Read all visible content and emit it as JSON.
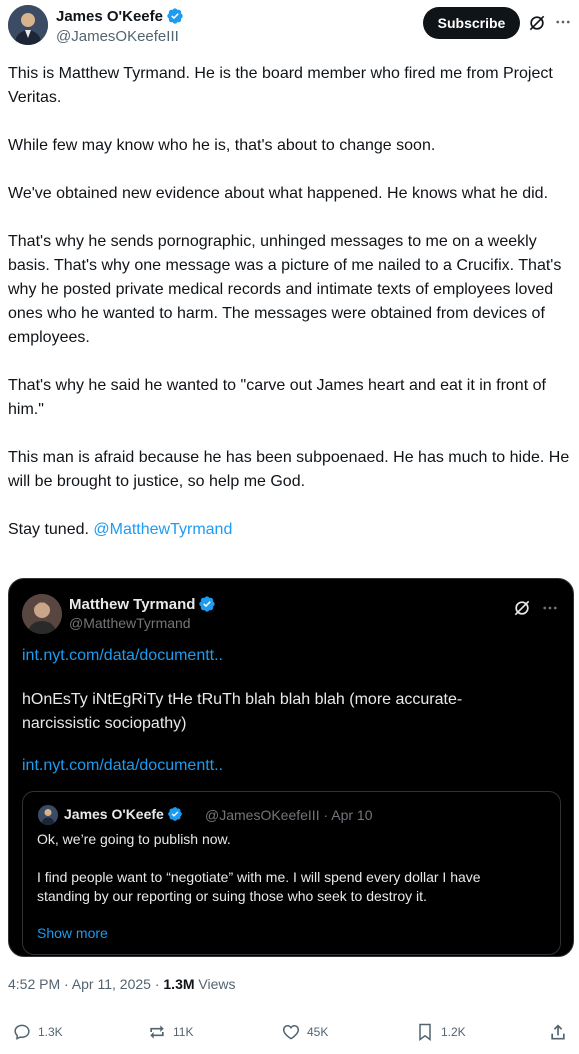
{
  "author": {
    "name": "James O'Keefe",
    "handle": "@JamesOKeefeIII"
  },
  "header": {
    "subscribe_label": "Subscribe"
  },
  "tweet": {
    "paragraphs": [
      "This is Matthew Tyrmand. He is the board member who fired me from Project Veritas.",
      "While few may know who he is, that's about to change soon.",
      "We've obtained new evidence about what happened. He knows what he did.",
      "That's why he sends pornographic, unhinged messages to me on a weekly basis.  That's why one message was a picture of me nailed to a Crucifix. That's why he posted private medical records and intimate texts of employees loved ones who he wanted to harm. The messages were obtained from devices of employees.",
      "That's why he said he wanted to \"carve out James heart and eat it in front of him.\"",
      "This man is afraid because he has been subpoenaed. He has much to hide. He will be brought to justice, so help me God."
    ],
    "closing_text": "Stay tuned. ",
    "mention": "@MatthewTyrmand"
  },
  "quote": {
    "name": "Matthew Tyrmand",
    "handle": "@MatthewTyrmand",
    "link1": "int.nyt.com/data/documentt..",
    "body": "hOnEsTy iNtEgRiTy tHe tRuTh blah blah blah (more accurate- narcissistic sociopathy)",
    "link2": "int.nyt.com/data/documentt..",
    "inner": {
      "name": "James O'Keefe",
      "handle_date": "@JamesOKeefeIII · Apr 10",
      "text1": "Ok, we’re going to publish now.",
      "text2": "I find people want to “negotiate” with me. I will spend every dollar I have standing by our reporting or suing those who seek to destroy it.",
      "show_more": "Show more"
    }
  },
  "meta": {
    "timestamp": "4:52 PM · Apr 11, 2025 · ",
    "views_count": "1.3M",
    "views_label": " Views"
  },
  "actions": {
    "replies": "1.3K",
    "reposts": "11K",
    "likes": "45K",
    "bookmarks": "1.2K"
  },
  "colors": {
    "accent": "#1d9bf0",
    "verified": "#1d9bf0",
    "text": "#0f1419",
    "muted": "#536471",
    "card_bg": "#000000"
  },
  "icons": [
    "verified-badge-icon",
    "grok-icon",
    "more-icon",
    "reply-icon",
    "repost-icon",
    "like-icon",
    "bookmark-icon",
    "share-icon"
  ]
}
